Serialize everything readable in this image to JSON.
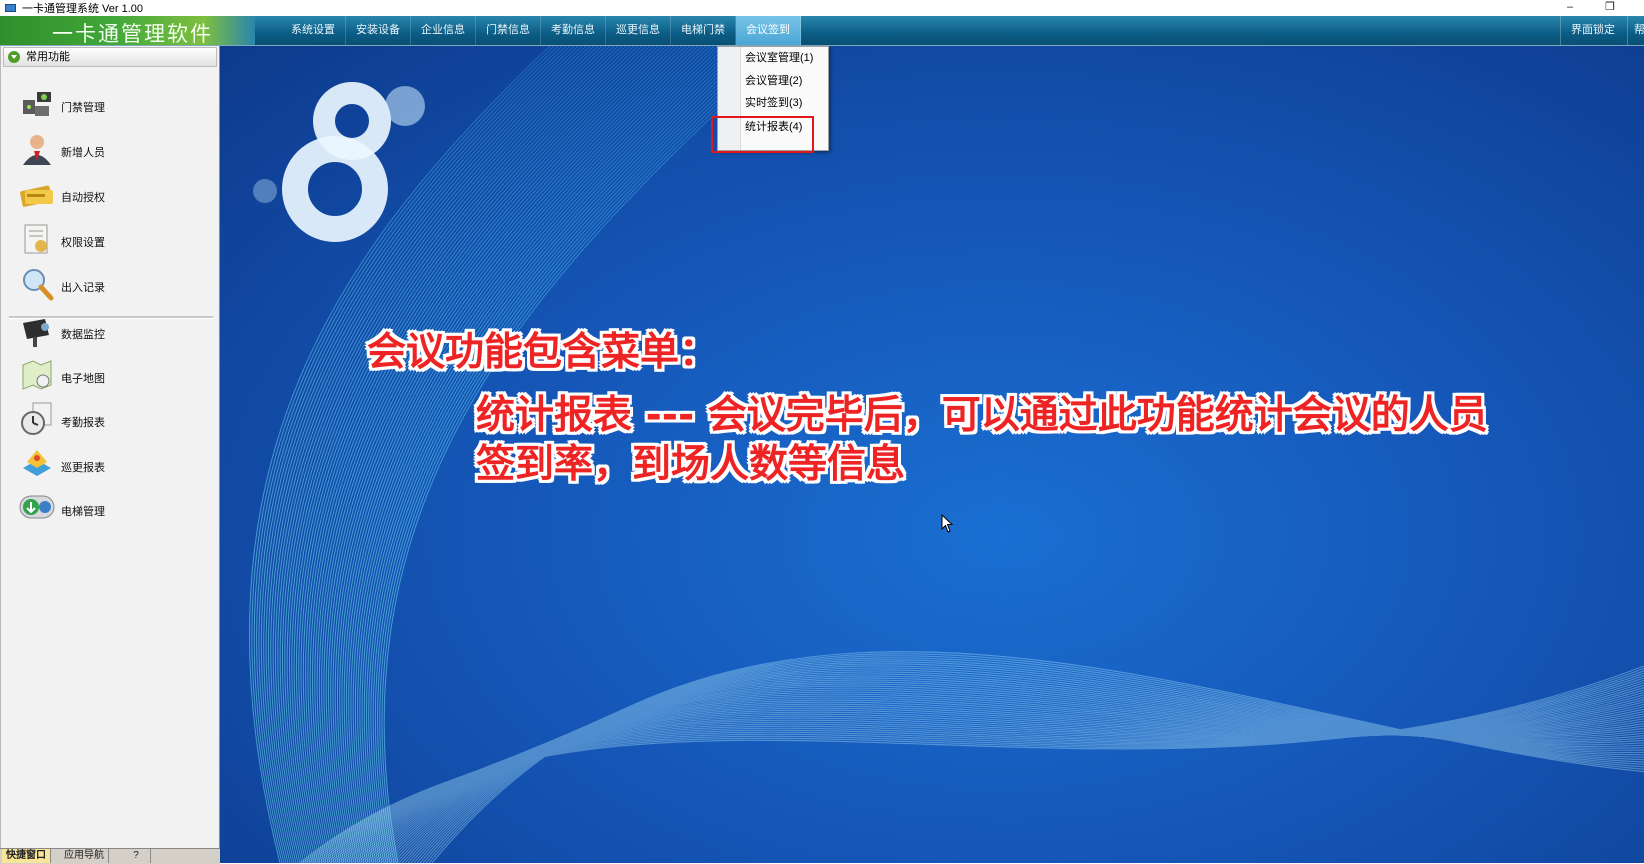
{
  "window": {
    "title": "一卡通管理系统  Ver 1.00",
    "minimize_glyph": "–",
    "restore_glyph": "❐"
  },
  "header": {
    "brand": "一卡通管理软件",
    "menu": [
      {
        "label": "系统设置"
      },
      {
        "label": "安装设备"
      },
      {
        "label": "企业信息"
      },
      {
        "label": "门禁信息"
      },
      {
        "label": "考勤信息"
      },
      {
        "label": "巡更信息"
      },
      {
        "label": "电梯门禁"
      },
      {
        "label": "会议签到"
      }
    ],
    "lock_label": "界面锁定",
    "help_label": "帮"
  },
  "dropdown": {
    "items": [
      {
        "label": "会议室管理(1)"
      },
      {
        "label": "会议管理(2)"
      },
      {
        "label": "实时签到(3)"
      },
      {
        "label": "统计报表(4)"
      }
    ],
    "highlight_color": "#e0171b"
  },
  "sidebar": {
    "title": "常用功能",
    "items": [
      {
        "label": "门禁管理",
        "icon": "door-access-icon"
      },
      {
        "label": "新增人员",
        "icon": "person-icon"
      },
      {
        "label": "自动授权",
        "icon": "card-icon"
      },
      {
        "label": "权限设置",
        "icon": "permission-icon"
      },
      {
        "label": "出入记录",
        "icon": "magnifier-icon"
      },
      {
        "label": "数据监控",
        "icon": "camera-icon"
      },
      {
        "label": "电子地图",
        "icon": "map-icon"
      },
      {
        "label": "考勤报表",
        "icon": "clock-icon"
      },
      {
        "label": "巡更报表",
        "icon": "patrol-icon"
      },
      {
        "label": "电梯管理",
        "icon": "elevator-icon"
      }
    ]
  },
  "bottom_tabs": [
    {
      "label": "快捷窗口"
    },
    {
      "label": "应用导航"
    },
    {
      "label": "?"
    }
  ],
  "annotation": {
    "heading": "会议功能包含菜单：",
    "body_line1": "统计报表 --- 会议完毕后，可以通过此功能统计会议的人员",
    "body_line2": "签到率，到场人数等信息",
    "color": "#ee2424"
  },
  "colors": {
    "accent_bar": "#0b5d86",
    "brand_green": "#42a83a",
    "main_bg": "#1557b8"
  }
}
